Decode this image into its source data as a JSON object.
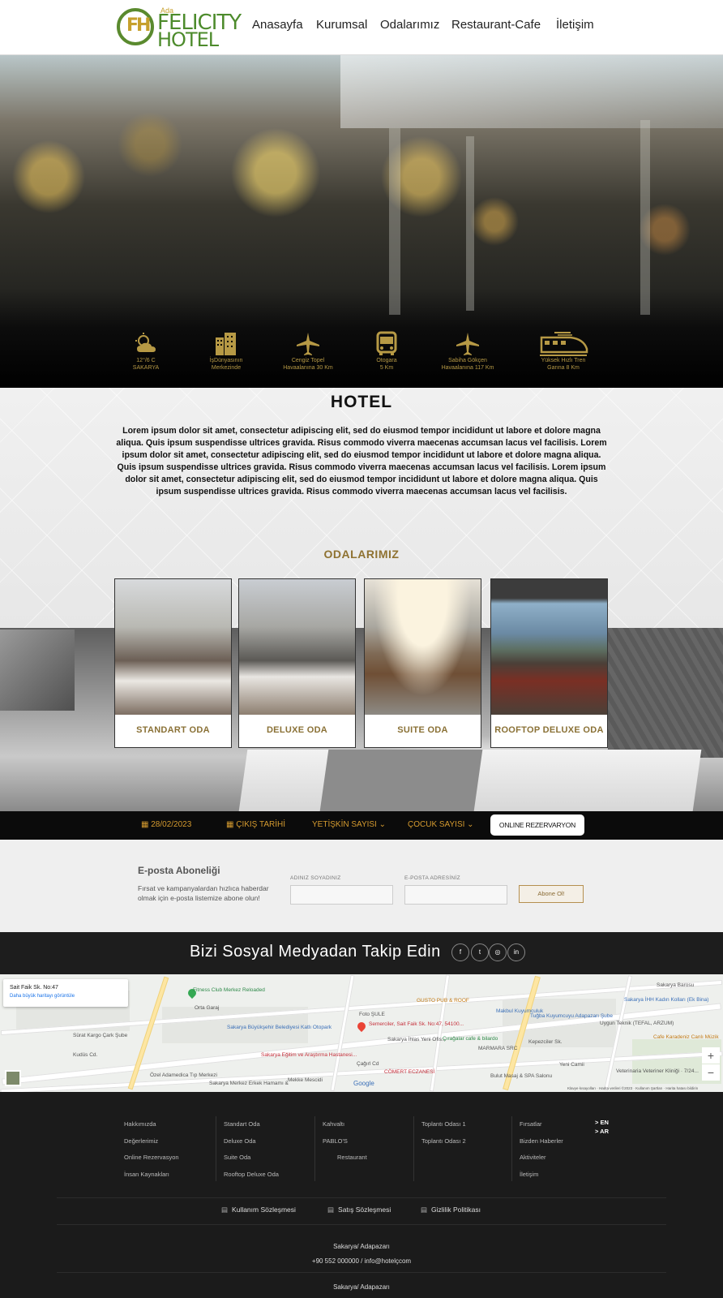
{
  "header": {
    "logo": {
      "small": "Ada",
      "line1": "FELICITY",
      "line2": "HOTEL",
      "monogram": "FH"
    },
    "nav": [
      "Anasayfa",
      "Kurumsal",
      "Odalarımız",
      "Restaurant-Cafe",
      "İletişim"
    ]
  },
  "hero": {
    "info_icons": [
      {
        "icon": "weather-icon",
        "line1": "12°/6 C",
        "line2": "SAKARYA"
      },
      {
        "icon": "buildings-icon",
        "line1": "İşDünyasının",
        "line2": "Merkezinde"
      },
      {
        "icon": "plane-icon",
        "line1": "Cengiz Topel",
        "line2": "Havaalanına 30 Km"
      },
      {
        "icon": "bus-icon",
        "line1": "Otogara",
        "line2": "5 Km"
      },
      {
        "icon": "plane-icon",
        "line1": "Sabiha Gökçen",
        "line2": "Havaalanına 117 Km"
      },
      {
        "icon": "train-icon",
        "line1": "Yüksek Hızlı Tren",
        "line2": "Garına 8 Km"
      }
    ]
  },
  "hotel": {
    "title": "HOTEL",
    "text": "Lorem ipsum dolor sit amet, consectetur adipiscing elit, sed do eiusmod tempor incididunt ut labore et dolore magna aliqua. Quis ipsum suspendisse ultrices gravida. Risus commodo viverra maecenas accumsan lacus vel facilisis. Lorem ipsum dolor sit amet, consectetur adipiscing elit, sed do eiusmod tempor incididunt ut labore et dolore magna aliqua. Quis ipsum suspendisse ultrices gravida. Risus commodo viverra maecenas accumsan lacus vel facilisis. Lorem ipsum dolor sit amet, consectetur adipiscing elit, sed do eiusmod tempor incididunt ut labore et dolore magna aliqua. Quis ipsum suspendisse ultrices gravida. Risus commodo viverra maecenas accumsan lacus vel facilisis."
  },
  "rooms": {
    "title": "ODALARIMIZ",
    "cards": [
      "STANDART ODA",
      "DELUXE ODA",
      "SUITE ODA",
      "ROOFTOP DELUXE ODA"
    ]
  },
  "booking": {
    "checkin": "28/02/2023",
    "checkout": "ÇIKIŞ TARİHİ",
    "adults": "YETİŞKİN SAYISI",
    "children": "ÇOCUK SAYISI",
    "button": "ONLINE REZERVARYON"
  },
  "newsletter": {
    "title": "E-posta Aboneliği",
    "desc": "Fırsat ve kampanyalardan hızlıca haberdar olmak için e-posta listemize abone olun!",
    "name_label": "ADINIZ SOYADINIZ",
    "email_label": "E-POSTA ADRESİNİZ",
    "button": "Abone Ol!"
  },
  "social": {
    "title": "Bizi Sosyal Medyadan Takip Edin",
    "icons": [
      "f",
      "t",
      "◎",
      "in"
    ]
  },
  "map": {
    "card_title": "Sait Faik Sk. No:47",
    "card_link": "Daha büyük haritayı görüntüle",
    "labels": {
      "fitness": "Fitness Club Merkez Reloaded",
      "orta_garaj": "Orta Garaj",
      "belediye": "Sakarya Büyükşehir Belediyesi Katlı Otopark",
      "kargo": "Sürat Kargo Çark Şube",
      "foto": "Foto ŞULE",
      "gusto": "GUSTO PUB & ROOF",
      "makbul": "Makbul Kuyumculuk",
      "tugba": "Tuğba Kuyumcuyu Adapazarı Şube",
      "ihh": "Sakarya İHH Kadın Kolları (Ek Bina)",
      "barosu": "Sakarya Barosu",
      "semerciler": "Semerciler, Sait Faik Sk. No:47, 54100...",
      "ihlas": "Sakarya İhlas Yeni Ofis...",
      "ciragalar": "Çırağalar cafe & bilardo",
      "kepezciler": "Kepezciler Sk.",
      "marmara": "MARMARA SRC",
      "uygun": "Uygun Teknik (TEFAL, ARZUM)",
      "karadeniz": "Cafe Karadeniz Canlı Müzik",
      "egitim": "Sakarya Eğitim ve Araştırma Hastanesi...",
      "cagrl": "Çağırl Cd",
      "comert": "CÖMERT ECZANESİ",
      "yeni_cami": "Yeni Camii",
      "veteriner": "Veterinaria Veteriner Kliniği · 7/24...",
      "ozel": "Özel Adamedica Tıp Merkezi",
      "hamam": "Sakarya Merkez Erkek Hamamı &",
      "mescid": "Mekke Mescidi",
      "bulut": "Bulut Masaj & SPA Salonu",
      "kudus": "Kudüs Cd.",
      "google": "Google",
      "legal": "Klavye kısayolları · Harita verileri ©2023 · Kullanım Şartları · Harita hatası bildirin"
    }
  },
  "footer": {
    "cols": [
      [
        "Hakkımızda",
        "Değerlerimiz",
        "Online Rezervasyon",
        "İnsan Kaynakları"
      ],
      [
        "Standart Oda",
        "Deluxe Oda",
        "Suite Oda",
        "Rooftop Deluxe Oda"
      ],
      [
        "Kahvaltı",
        "PABLO'S",
        "Restaurant"
      ],
      [
        "Toplantı Odası 1",
        "Toplantı Odası 2"
      ],
      [
        "Fırsatlar",
        "Bizden Haberler",
        "Aktiviteler",
        "İletişim"
      ]
    ],
    "lang": [
      "> EN",
      "> AR"
    ],
    "links": [
      "Kullanım Sözleşmesi",
      "Satış Sözleşmesi",
      "Gizlilik Politikası"
    ],
    "address1": "Sakarya/ Adapazarı",
    "contact": "+90 552 000000 / info@hotelçcom",
    "address2": "Sakarya/ Adapazarı"
  }
}
